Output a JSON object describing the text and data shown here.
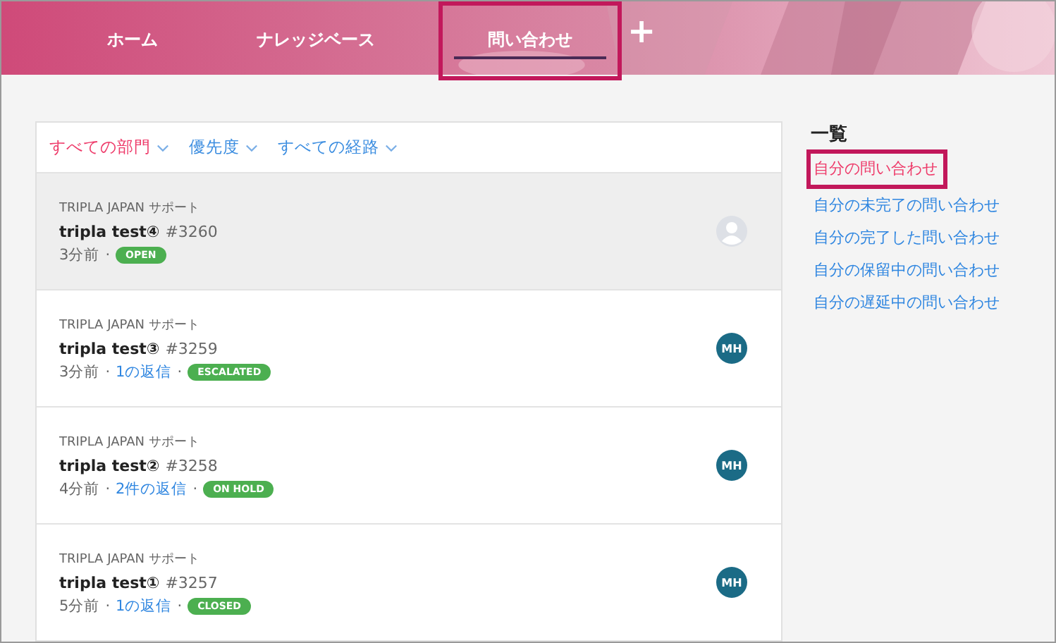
{
  "nav": {
    "tabs": [
      {
        "label": "ホーム",
        "selected": false,
        "highlighted": false
      },
      {
        "label": "ナレッジベース",
        "selected": false,
        "highlighted": false
      },
      {
        "label": "問い合わせ",
        "selected": true,
        "highlighted": true
      }
    ],
    "add": "+"
  },
  "filters": [
    {
      "label": "すべての部門",
      "active": true
    },
    {
      "label": "優先度",
      "active": false
    },
    {
      "label": "すべての経路",
      "active": false
    }
  ],
  "tickets": [
    {
      "source": "TRIPLA JAPAN サポート",
      "title": "tripla test④",
      "number": "#3260",
      "age": "3分前",
      "separators": [
        "·"
      ],
      "status": "OPEN",
      "selected": true,
      "avatar": {
        "kind": "placeholder"
      }
    },
    {
      "source": "TRIPLA JAPAN サポート",
      "title": "tripla test③",
      "number": "#3259",
      "age": "3分前",
      "separators": [
        "·",
        "·"
      ],
      "replies": "1の返信",
      "status": "ESCALATED",
      "selected": false,
      "avatar": {
        "kind": "initials",
        "text": "MH"
      }
    },
    {
      "source": "TRIPLA JAPAN サポート",
      "title": "tripla test②",
      "number": "#3258",
      "age": "4分前",
      "separators": [
        "·",
        "·"
      ],
      "replies": "2件の返信",
      "status": "ON HOLD",
      "selected": false,
      "avatar": {
        "kind": "initials",
        "text": "MH"
      }
    },
    {
      "source": "TRIPLA JAPAN サポート",
      "title": "tripla test①",
      "number": "#3257",
      "age": "5分前",
      "separators": [
        "·",
        "·"
      ],
      "replies": "1の返信",
      "status": "CLOSED",
      "selected": false,
      "avatar": {
        "kind": "initials",
        "text": "MH"
      }
    }
  ],
  "sidebar": {
    "heading": "一覧",
    "items": [
      {
        "label": "自分の問い合わせ",
        "selected": true,
        "highlighted": true
      },
      {
        "label": "自分の未完了の問い合わせ",
        "selected": false,
        "highlighted": false
      },
      {
        "label": "自分の完了した問い合わせ",
        "selected": false,
        "highlighted": false
      },
      {
        "label": "自分の保留中の問い合わせ",
        "selected": false,
        "highlighted": false
      },
      {
        "label": "自分の遅延中の問い合わせ",
        "selected": false,
        "highlighted": false
      }
    ]
  }
}
